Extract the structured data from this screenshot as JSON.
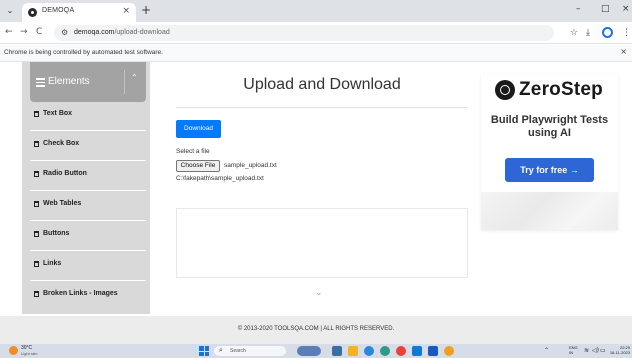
{
  "browser": {
    "tab": {
      "title": "DEMOQA",
      "close": "×"
    },
    "tab_list": "⌄",
    "new_tab": "+",
    "window_controls": {
      "minimize": "–",
      "maximize": "□",
      "close": "×"
    },
    "nav": {
      "back": "←",
      "forward": "→",
      "reload": "C"
    },
    "site_info_icon": "⚙",
    "url_host": "demoqa.com",
    "url_path": "/upload-download",
    "bookmark": "☆",
    "downloads": "⤓",
    "menu": "⋮",
    "infobar_text": "Chrome is being controlled by automated test software.",
    "infobar_close": "×"
  },
  "sidebar": {
    "group_title": "Elements",
    "collapse_arrow": "⌃",
    "items": [
      {
        "label": "Text Box"
      },
      {
        "label": "Check Box"
      },
      {
        "label": "Radio Button"
      },
      {
        "label": "Web Tables"
      },
      {
        "label": "Buttons"
      },
      {
        "label": "Links"
      },
      {
        "label": "Broken Links - Images"
      }
    ]
  },
  "main": {
    "title": "Upload and Download",
    "download_label": "Download",
    "file_label": "Select a file",
    "choose_file_label": "Choose File",
    "chosen_file": "sample_upload.txt",
    "uploaded_path": "C:\\fakepath\\sample_upload.txt",
    "scroll_chevron": "⌄"
  },
  "ad": {
    "brand": "ZeroStep",
    "headline": "Build Playwright Tests using AI",
    "cta": "Try for free →"
  },
  "footer": {
    "text": "© 2013-2020 TOOLSQA.COM | ALL RIGHTS RESERVED."
  },
  "taskbar": {
    "weather_temp": "30°C",
    "weather_desc": "Light rain",
    "search_icon": "⌕",
    "search_placeholder": "Search",
    "tray_up": "⌃",
    "lang_top": "ENG",
    "lang_bottom": "IN",
    "wifi": "≋",
    "volume": "◁)",
    "battery": "▭",
    "clock_time": "22:29",
    "clock_date": "16-11-2023"
  },
  "colors": {
    "primary_button": "#007bff",
    "ad_cta": "#2f66d6",
    "sidebar_header": "#a3a3a3",
    "sidebar_bg": "#d9d9d9"
  }
}
